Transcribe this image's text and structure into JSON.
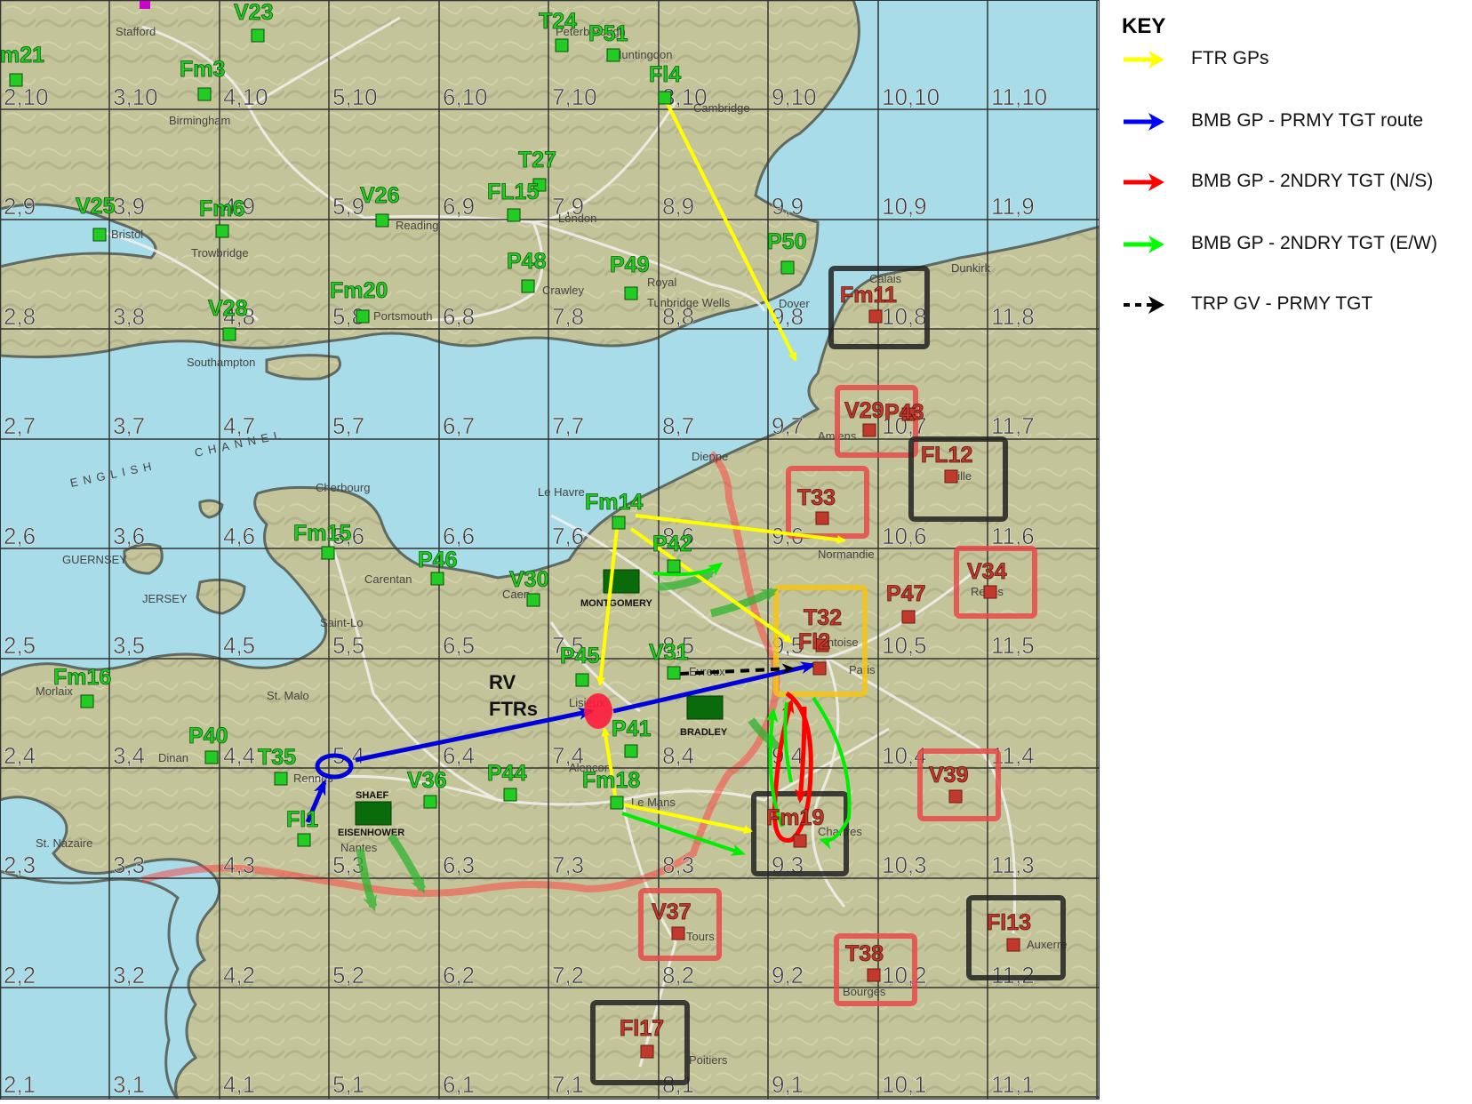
{
  "key": {
    "title": "KEY",
    "items": [
      {
        "label": "FTR GPs",
        "color": "#ffff00",
        "style": "solid"
      },
      {
        "label": "BMB GP - PRMY TGT route",
        "color": "#0000ff",
        "style": "solid"
      },
      {
        "label": "BMB GP - 2NDRY  TGT (N/S)",
        "color": "#ff0000",
        "style": "solid"
      },
      {
        "label": "BMB GP - 2NDRY  TGT (E/W)",
        "color": "#00ff00",
        "style": "solid"
      },
      {
        "label": "TRP GV - PRMY TGT",
        "color": "#000000",
        "style": "dashed"
      }
    ]
  },
  "grid_labels": [
    "2,10",
    "3,10",
    "4,10",
    "5,10",
    "6,10",
    "7,10",
    "8,10",
    "9,10",
    "10,10",
    "11,10",
    "2,9",
    "3,9",
    "4,9",
    "5,9",
    "6,9",
    "7,9",
    "8,9",
    "9,9",
    "10,9",
    "11,9",
    "2,8",
    "3,8",
    "4,8",
    "5,8",
    "6,8",
    "7,8",
    "8,8",
    "9,8",
    "10,8",
    "11,8",
    "2,7",
    "3,7",
    "4,7",
    "5,7",
    "6,7",
    "7,7",
    "8,7",
    "9,7",
    "10,7",
    "11,7",
    "2,6",
    "3,6",
    "4,6",
    "5,6",
    "6,6",
    "7,6",
    "8,6",
    "9,6",
    "10,6",
    "11,6",
    "2,5",
    "3,5",
    "4,5",
    "5,5",
    "6,5",
    "7,5",
    "8,5",
    "9,5",
    "10,5",
    "11,5",
    "2,4",
    "3,4",
    "4,4",
    "5,4",
    "6,4",
    "7,4",
    "8,4",
    "9,4",
    "10,4",
    "11,4",
    "2,3",
    "3,3",
    "4,3",
    "5,3",
    "6,3",
    "7,3",
    "8,3",
    "9,3",
    "10,3",
    "11,3",
    "2,2",
    "3,2",
    "4,2",
    "5,2",
    "6,2",
    "7,2",
    "8,2",
    "9,2",
    "10,2",
    "11,2",
    "2,1",
    "3,1",
    "4,1",
    "5,1",
    "6,1",
    "7,1",
    "8,1",
    "9,1",
    "10,1",
    "11,1"
  ],
  "place_names": [
    "Stafford",
    "Peterborough",
    "Huntingdon",
    "Birmingham",
    "Cambridge",
    "Bristol",
    "Reading",
    "London",
    "Trowbridge",
    "Crawley",
    "Royal",
    "Tunbridge Wells",
    "Dover",
    "Calais",
    "Dunkirk",
    "Portsmouth",
    "Southampton",
    "ENGLISH",
    "CHANNEL",
    "Dieppe",
    "Amiens",
    "Lille",
    "Cherbourg",
    "Le Havre",
    "Normandie",
    "GUERNSEY",
    "Carentan",
    "Caen",
    "JERSEY",
    "Saint-Lo",
    "Reims",
    "Pontoise",
    "Paris",
    "Evreux",
    "Lisieux",
    "St. Malo",
    "Morlaix",
    "Alencon",
    "Dinan",
    "Rennes",
    "Le Mans",
    "Chartres",
    "St. Nazaire",
    "Nantes",
    "Tours",
    "Auxerre",
    "Bourges",
    "Poitiers"
  ],
  "allied_units": [
    "m21",
    "V23",
    "T24",
    "P51",
    "Fm3",
    "Fl4",
    "T27",
    "V25",
    "Fm6",
    "V26",
    "FL15",
    "P48",
    "P49",
    "P50",
    "V28",
    "Fm20",
    "Fm14",
    "P42",
    "Fm15",
    "P46",
    "V30",
    "P45",
    "V31",
    "Fm16",
    "P41",
    "P40",
    "T35",
    "V36",
    "P44",
    "Fm18",
    "Fl1"
  ],
  "target_units": [
    {
      "id": "Fm11",
      "box_color": "#222222"
    },
    {
      "id": "V29",
      "box_color": "#e84a4a"
    },
    {
      "id": "P43",
      "box_color": ""
    },
    {
      "id": "FL12",
      "box_color": "#222222"
    },
    {
      "id": "T33",
      "box_color": "#e84a4a"
    },
    {
      "id": "V34",
      "box_color": "#e84a4a"
    },
    {
      "id": "P47",
      "box_color": ""
    },
    {
      "id": "T32",
      "box_color": "#f5c518"
    },
    {
      "id": "Fl2",
      "box_color": ""
    },
    {
      "id": "V39",
      "box_color": "#e84a4a"
    },
    {
      "id": "Fm19",
      "box_color": "#222222"
    },
    {
      "id": "V37",
      "box_color": "#e84a4a"
    },
    {
      "id": "Fl13",
      "box_color": "#222222"
    },
    {
      "id": "T38",
      "box_color": "#e84a4a"
    },
    {
      "id": "Fl17",
      "box_color": "#222222"
    }
  ],
  "hq_units": [
    "MONTGOMERY",
    "BRADLEY",
    "SHAEF",
    "EISENHOWER"
  ],
  "rv_label": [
    "RV",
    "FTRs"
  ],
  "colors": {
    "sea": "#a8dce8",
    "land": "#c4c49a",
    "allied_unit": "#22cc22",
    "target_unit": "#c0392b",
    "hq": "#0a6b0a",
    "rv": "#ff1a3c"
  }
}
